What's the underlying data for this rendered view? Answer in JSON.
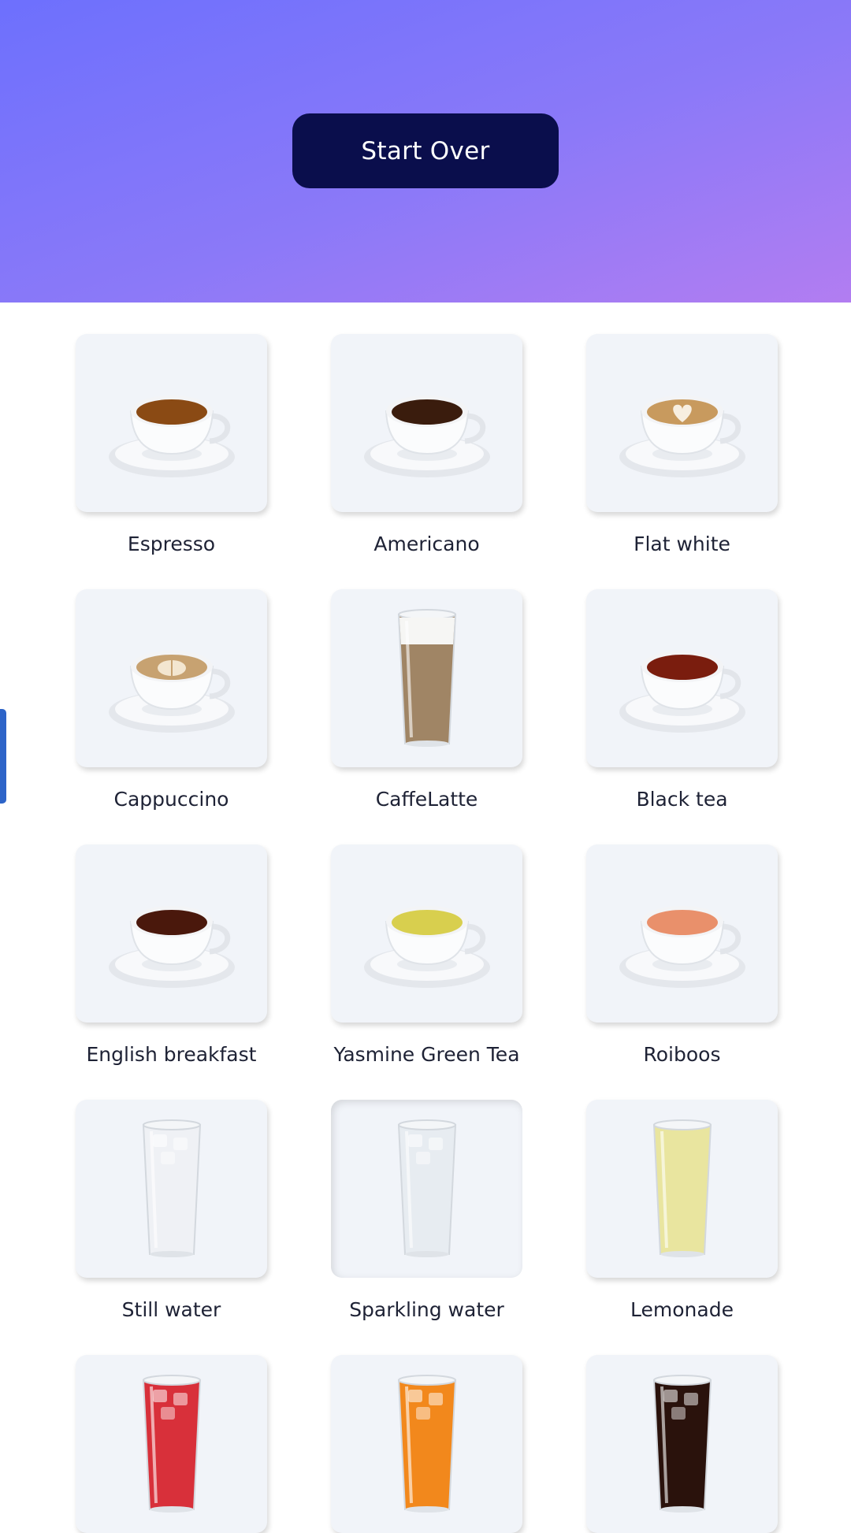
{
  "header": {
    "start_over_label": "Start Over"
  },
  "drinks": [
    {
      "label": "Espresso",
      "icon": "espresso-cup-icon",
      "liquid": "#8a4a14"
    },
    {
      "label": "Americano",
      "icon": "americano-cup-icon",
      "liquid": "#3a1c0d"
    },
    {
      "label": "Flat white",
      "icon": "flat-white-cup-icon",
      "liquid": "#c89a5e"
    },
    {
      "label": "Cappuccino",
      "icon": "cappuccino-cup-icon",
      "liquid": "#c7a271"
    },
    {
      "label": "CaffeLatte",
      "icon": "caffe-latte-glass-icon",
      "liquid": "#a08565"
    },
    {
      "label": "Black tea",
      "icon": "black-tea-cup-icon",
      "liquid": "#7a1d0e"
    },
    {
      "label": "English breakfast",
      "icon": "english-breakfast-cup-icon",
      "liquid": "#4a180c"
    },
    {
      "label": "Yasmine Green Tea",
      "icon": "green-tea-cup-icon",
      "liquid": "#d8cf4e"
    },
    {
      "label": "Roiboos",
      "icon": "rooibos-cup-icon",
      "liquid": "#e9906b"
    },
    {
      "label": "Still water",
      "icon": "still-water-glass-icon",
      "liquid": "#eef1f4"
    },
    {
      "label": "Sparkling water",
      "icon": "sparkling-water-glass-icon",
      "liquid": "#e6ebf0"
    },
    {
      "label": "Lemonade",
      "icon": "lemonade-glass-icon",
      "liquid": "#e8e49a"
    },
    {
      "label": "",
      "icon": "red-iced-drink-glass-icon",
      "liquid": "#d8303a"
    },
    {
      "label": "",
      "icon": "orange-iced-drink-glass-icon",
      "liquid": "#f2881c"
    },
    {
      "label": "",
      "icon": "cola-glass-icon",
      "liquid": "#2a120c"
    }
  ]
}
